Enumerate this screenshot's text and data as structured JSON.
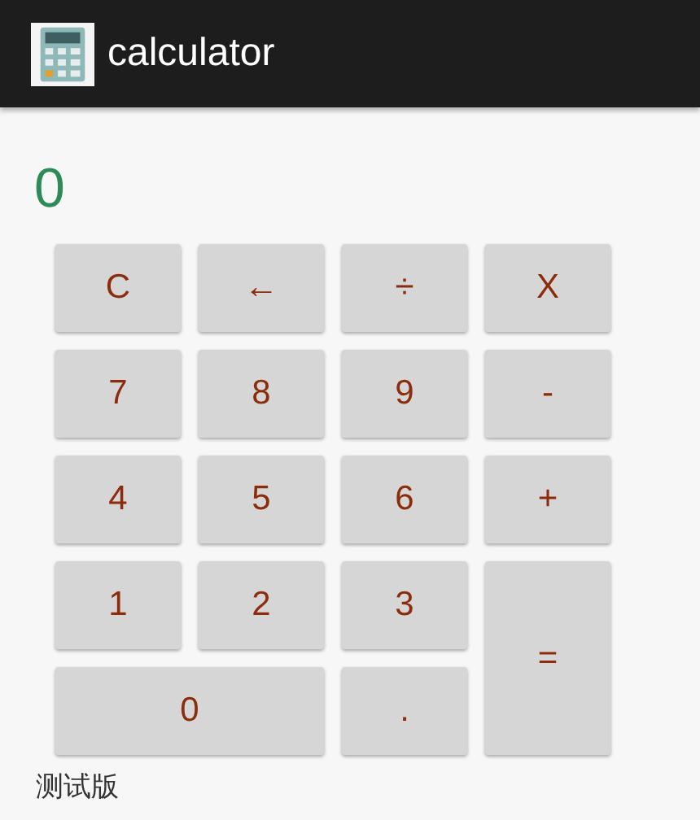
{
  "app_bar": {
    "title": "calculator"
  },
  "display": {
    "value": "0"
  },
  "keys": [
    {
      "label": "C",
      "kind": "normal"
    },
    {
      "label": "←",
      "kind": "normal"
    },
    {
      "label": "÷",
      "kind": "normal"
    },
    {
      "label": "X",
      "kind": "normal"
    },
    {
      "label": "7",
      "kind": "normal"
    },
    {
      "label": "8",
      "kind": "normal"
    },
    {
      "label": "9",
      "kind": "normal"
    },
    {
      "label": "-",
      "kind": "normal"
    },
    {
      "label": "4",
      "kind": "normal"
    },
    {
      "label": "5",
      "kind": "normal"
    },
    {
      "label": "6",
      "kind": "normal"
    },
    {
      "label": "+",
      "kind": "normal"
    },
    {
      "label": "1",
      "kind": "normal"
    },
    {
      "label": "2",
      "kind": "normal"
    },
    {
      "label": "3",
      "kind": "normal"
    },
    {
      "label": "=",
      "kind": "tall"
    },
    {
      "label": "0",
      "kind": "wide"
    },
    {
      "label": ".",
      "kind": "normal"
    }
  ],
  "footer": {
    "text": "测试版"
  }
}
